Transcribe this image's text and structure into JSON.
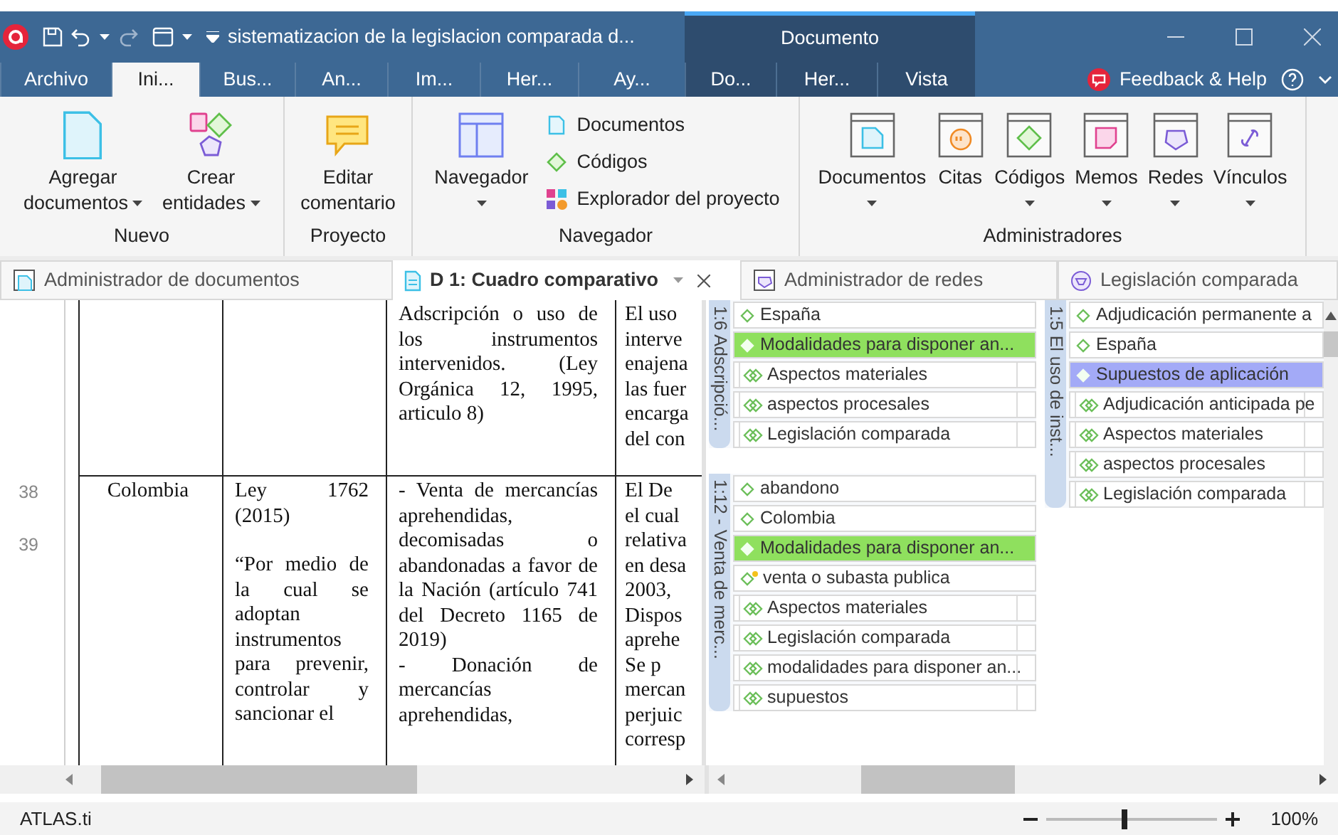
{
  "title_bar": {
    "title": "sistematizacion de la legislacion comparada d...",
    "context_label": "Documento"
  },
  "ribbon_tabs": [
    {
      "label": "Archivo",
      "selected": false,
      "context": false
    },
    {
      "label": "Ini...",
      "selected": true,
      "context": false
    },
    {
      "label": "Bus...",
      "selected": false,
      "context": false
    },
    {
      "label": "An...",
      "selected": false,
      "context": false
    },
    {
      "label": "Im...",
      "selected": false,
      "context": false
    },
    {
      "label": "Her...",
      "selected": false,
      "context": false
    },
    {
      "label": "Ay...",
      "selected": false,
      "context": false
    },
    {
      "label": "Do...",
      "selected": false,
      "context": true
    },
    {
      "label": "Her...",
      "selected": false,
      "context": true
    },
    {
      "label": "Vista",
      "selected": false,
      "context": true
    }
  ],
  "feedback": "Feedback & Help",
  "ribbon_groups": [
    {
      "label": "Nuevo",
      "items": [
        {
          "kind": "large",
          "lines": [
            "Agregar",
            "documentos"
          ],
          "dropdown": true
        },
        {
          "kind": "large",
          "lines": [
            "Crear",
            "entidades"
          ],
          "dropdown": true
        }
      ]
    },
    {
      "label": "Proyecto",
      "items": [
        {
          "kind": "large",
          "lines": [
            "Editar",
            "comentario"
          ],
          "dropdown": false
        }
      ]
    },
    {
      "label": "Navegador",
      "items": [
        {
          "kind": "tall",
          "lines": [
            "Navegador"
          ],
          "dropdown": true
        },
        {
          "kind": "stack",
          "entries": [
            "Documentos",
            "Códigos",
            "Explorador del proyecto"
          ]
        }
      ]
    },
    {
      "label": "Administradores",
      "items": [
        {
          "kind": "tall",
          "lines": [
            "Documentos"
          ],
          "dropdown": true
        },
        {
          "kind": "tall",
          "lines": [
            "Citas"
          ],
          "dropdown": false
        },
        {
          "kind": "tall",
          "lines": [
            "Códigos"
          ],
          "dropdown": true
        },
        {
          "kind": "tall",
          "lines": [
            "Memos"
          ],
          "dropdown": true
        },
        {
          "kind": "tall",
          "lines": [
            "Redes"
          ],
          "dropdown": true
        },
        {
          "kind": "tall",
          "lines": [
            "Vínculos"
          ],
          "dropdown": true
        }
      ]
    }
  ],
  "doc_tabs": [
    {
      "label": "Administrador de documentos",
      "selected": false
    },
    {
      "label": "D 1: Cuadro comparativo",
      "selected": true
    },
    {
      "label": "Administrador de redes",
      "selected": false
    },
    {
      "label": "Legislación comparada",
      "selected": false
    }
  ],
  "document": {
    "line_numbers": [
      "38",
      "39"
    ],
    "rows": [
      {
        "cells": [
          {
            "kind": "text"
          },
          {
            "kind": "text"
          },
          {
            "kind": "text",
            "paragraphs": [
              "Adscripción o uso de los instrumentos intervenidos. (Ley Orgánica 12, 1995, articulo 8)"
            ]
          },
          {
            "kind": "clipped",
            "lines": [
              "El uso",
              "interve",
              "enajena",
              "las fuer",
              "encarga",
              "del con"
            ]
          }
        ]
      },
      {
        "cells": [
          {
            "kind": "centered",
            "paragraphs": [
              "Colombia"
            ]
          },
          {
            "kind": "spaced",
            "paragraphs": [
              "Ley 1762 (2015)",
              "“Por medio de la cual se adoptan instrumentos para prevenir, controlar y sancionar el"
            ]
          },
          {
            "kind": "text",
            "paragraphs": [
              "- Venta de mercancías aprehendidas, decomisadas o abandonadas a favor de la Nación (artículo 741 del Decreto 1165 de 2019)",
              "- Donación de mercancías aprehendidas,"
            ]
          },
          {
            "kind": "clipped",
            "lines": [
              "El De",
              "el cual",
              "relativa",
              "en desa",
              "2003,",
              "Dispos",
              "aprehe",
              "Se p",
              "mercan",
              "perjuic",
              "corresp"
            ]
          }
        ]
      }
    ]
  },
  "margin": {
    "columns": [
      {
        "groups": [
          {
            "label": "1:6 Adscripció...",
            "codes": [
              {
                "label": "España",
                "kind": "code",
                "color": "#ffffff"
              },
              {
                "label": "Modalidades para disponer an...",
                "kind": "code",
                "color": "#8fe05e"
              },
              {
                "label": "Aspectos materiales",
                "kind": "group",
                "color": "#ffffff"
              },
              {
                "label": "aspectos procesales",
                "kind": "group",
                "color": "#ffffff"
              },
              {
                "label": "Legislación comparada",
                "kind": "group",
                "color": "#ffffff"
              }
            ]
          },
          {
            "label": "1:12 - Venta de merc...",
            "codes": [
              {
                "label": "abandono",
                "kind": "code",
                "color": "#ffffff"
              },
              {
                "label": "Colombia",
                "kind": "code",
                "color": "#ffffff"
              },
              {
                "label": "Modalidades para disponer an...",
                "kind": "code",
                "color": "#8fe05e"
              },
              {
                "label": "venta o subasta publica",
                "kind": "new",
                "color": "#ffffff"
              },
              {
                "label": "Aspectos materiales",
                "kind": "group",
                "color": "#ffffff"
              },
              {
                "label": "Legislación comparada",
                "kind": "group",
                "color": "#ffffff"
              },
              {
                "label": "modalidades para disponer an...",
                "kind": "group",
                "color": "#ffffff"
              },
              {
                "label": "supuestos",
                "kind": "group",
                "color": "#ffffff"
              }
            ]
          }
        ]
      },
      {
        "groups": [
          {
            "label": "1:5 El uso de inst...",
            "codes": [
              {
                "label": "Adjudicación permanente a",
                "kind": "code",
                "color": "#ffffff"
              },
              {
                "label": "España",
                "kind": "code",
                "color": "#ffffff"
              },
              {
                "label": "Supuestos de aplicación",
                "kind": "code",
                "color": "#a3aaf7"
              },
              {
                "label": "Adjudicación anticipada pe",
                "kind": "group",
                "color": "#ffffff"
              },
              {
                "label": "Aspectos materiales",
                "kind": "group",
                "color": "#ffffff"
              },
              {
                "label": "aspectos procesales",
                "kind": "group",
                "color": "#ffffff"
              },
              {
                "label": "Legislación comparada",
                "kind": "group",
                "color": "#ffffff"
              }
            ]
          }
        ]
      }
    ]
  },
  "status_bar": {
    "app_name": "ATLAS.ti",
    "zoom": {
      "level": 0.46,
      "reading": "100%"
    }
  }
}
